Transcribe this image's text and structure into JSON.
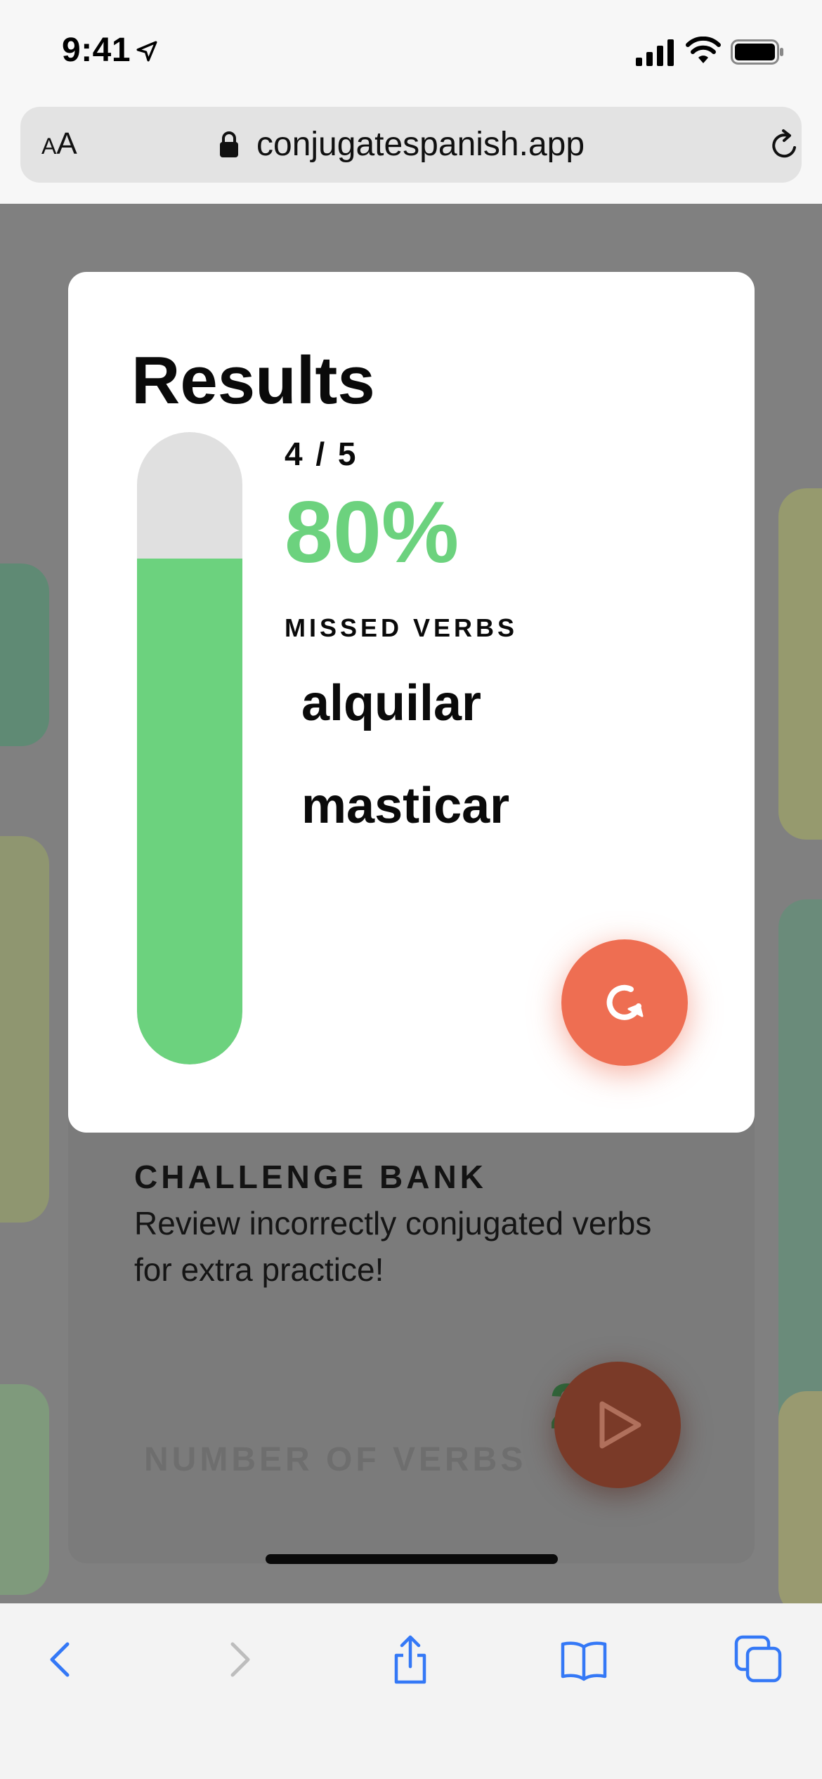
{
  "status_bar": {
    "time": "9:41",
    "icons": [
      "location-arrow-icon",
      "cellular-signal-icon",
      "wifi-icon",
      "battery-icon"
    ]
  },
  "address_bar": {
    "text_size_small": "A",
    "text_size_big": "A",
    "url": "conjugatespanish.app",
    "icons": [
      "lock-icon",
      "reload-icon"
    ]
  },
  "results": {
    "title": "Results",
    "score_fraction": "4 / 5",
    "score_percent": "80%",
    "progress_fraction": 0.8,
    "missed_label": "MISSED VERBS",
    "missed_verbs": [
      "alquilar",
      "masticar"
    ],
    "retry_icon": "retry-icon",
    "colors": {
      "accent_green": "#6cd27e",
      "track_gray": "#e0e0e0",
      "retry_orange": "#ee6e52"
    }
  },
  "challenge_bank": {
    "title": "CHALLENGE BANK",
    "description": "Review incorrectly conjugated verbs for extra practice!",
    "count": "2",
    "count_label": "NUMBER OF VERBS",
    "play_icon": "play-icon"
  },
  "toolbar": {
    "icons": [
      "back-icon",
      "forward-icon",
      "share-icon",
      "bookmarks-icon",
      "tabs-icon"
    ]
  }
}
